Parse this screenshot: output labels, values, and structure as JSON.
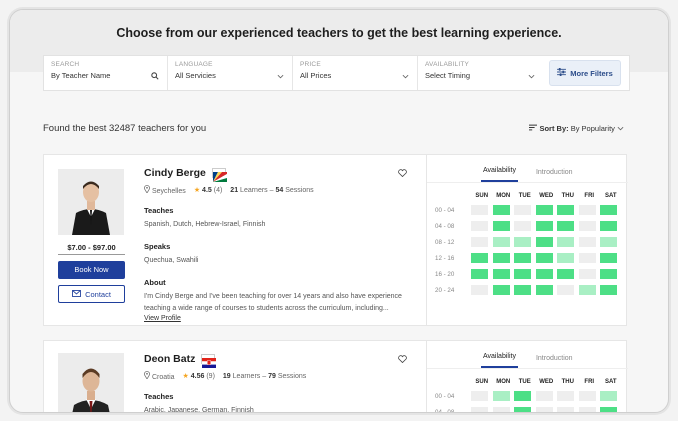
{
  "hero": {
    "title": "Choose from our experienced teachers to get the best learning experience."
  },
  "search": {
    "fields": [
      {
        "label": "SEARCH",
        "value": "By Teacher Name",
        "icon": "search-icon"
      },
      {
        "label": "LANGUAGE",
        "value": "All Servicies",
        "icon": "chevron-down-icon"
      },
      {
        "label": "PRICE",
        "value": "All Prices",
        "icon": "chevron-down-icon"
      },
      {
        "label": "AVAILABILITY",
        "value": "Select Timing",
        "icon": "chevron-down-icon"
      }
    ],
    "more_filters": "More Filters"
  },
  "results": {
    "found_text": "Found the best 32487 teachers for you",
    "sort_label": "Sort By:",
    "sort_value": "By Popularity"
  },
  "days": [
    "SUN",
    "MON",
    "TUE",
    "WED",
    "THU",
    "FRI",
    "SAT"
  ],
  "time_slots": [
    "00 - 04",
    "04 - 08",
    "08 - 12",
    "12 - 16",
    "16 - 20",
    "20 - 24"
  ],
  "teachers": [
    {
      "name": "Cindy Berge",
      "country": "Seychelles",
      "rating": "4.5",
      "rating_count": "(4)",
      "learners_num": "21",
      "learners_label": "Learners",
      "sessions_num": "54",
      "sessions_label": "Sessions",
      "teaches_label": "Teaches",
      "teaches": "Spanish, Dutch, Hebrew-Israel, Finnish",
      "speaks_label": "Speaks",
      "speaks": "Quechua, Swahili",
      "about_label": "About",
      "about": "I'm Cindy Berge and I've been teaching for over 14 years and also have experience teaching a wide range of courses to students across the curriculum, including...",
      "view_profile": "View Profile",
      "price": "$7.00 - $97.00",
      "book_now": "Book Now",
      "contact": "Contact",
      "tab_availability": "Availability",
      "tab_introduction": "Introduction",
      "availability": [
        [
          0,
          1,
          0,
          1,
          1,
          0,
          1
        ],
        [
          0,
          1,
          0,
          1,
          1,
          0,
          1
        ],
        [
          0,
          2,
          2,
          1,
          2,
          0,
          2
        ],
        [
          1,
          1,
          1,
          1,
          2,
          0,
          1
        ],
        [
          1,
          1,
          1,
          1,
          1,
          0,
          1
        ],
        [
          0,
          1,
          1,
          1,
          0,
          2,
          1
        ]
      ]
    },
    {
      "name": "Deon Batz",
      "country": "Croatia",
      "rating": "4.56",
      "rating_count": "(9)",
      "learners_num": "19",
      "learners_label": "Learners",
      "sessions_num": "79",
      "sessions_label": "Sessions",
      "teaches_label": "Teaches",
      "teaches": "Arabic, Japanese, German, Finnish",
      "tab_availability": "Availability",
      "tab_introduction": "Introduction",
      "availability": [
        [
          0,
          2,
          1,
          0,
          0,
          0,
          2
        ],
        [
          0,
          0,
          1,
          0,
          0,
          0,
          1
        ]
      ]
    }
  ],
  "colors": {
    "primary": "#1f3f9c",
    "slot_available": "#4ddf86",
    "slot_partial": "#a9efc4",
    "slot_empty": "#eeeeee",
    "star": "#f5a623"
  }
}
